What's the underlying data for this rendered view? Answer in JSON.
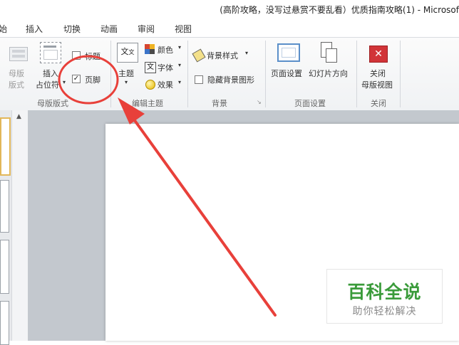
{
  "window": {
    "title": "(高阶攻略，没写过悬赏不要乱看）优质指南攻略(1) - Microsof"
  },
  "tabs": [
    "始",
    "插入",
    "切换",
    "动画",
    "审阅",
    "视图"
  ],
  "groups": {
    "master_layout": {
      "label": "母版版式",
      "master_layout_button": [
        "母版",
        "版式"
      ],
      "insert_placeholder_button": [
        "插入",
        "占位符"
      ],
      "title_checkbox": {
        "label": "标题",
        "checked": false
      },
      "footer_checkbox": {
        "label": "页脚",
        "checked": true
      }
    },
    "edit_theme": {
      "label": "编辑主题",
      "theme_button": "主题",
      "colors": "颜色",
      "fonts": "字体",
      "effects": "效果"
    },
    "background": {
      "label": "背景",
      "background_styles": "背景样式",
      "hide_background_graphics": {
        "label": "隐藏背景图形",
        "checked": false
      }
    },
    "page_setup": {
      "label": "页面设置",
      "page_setup_button": "页面设置",
      "slide_orientation_button": "幻灯片方向"
    },
    "close": {
      "label": "关闭",
      "close_master_view_button": [
        "关闭",
        "母版视图"
      ]
    }
  },
  "watermark": {
    "main": "百科全说",
    "sub": "助你轻松解决"
  },
  "colors": {
    "annotation": "#e8403a",
    "watermark_green": "#3a9b3a",
    "close_red": "#d13438"
  }
}
